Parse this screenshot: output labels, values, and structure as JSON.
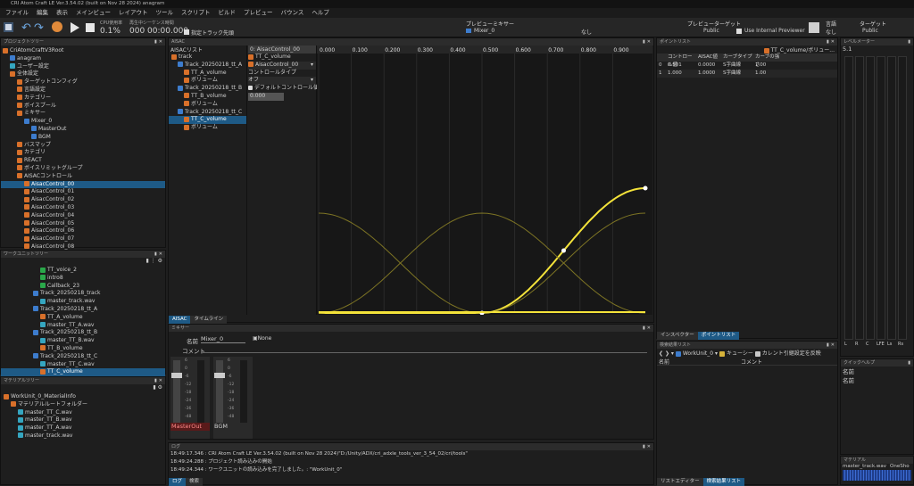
{
  "app": {
    "title": "CRI Atom Craft LE Ver.3.54.02 (built on Nov 28 2024)  anagram"
  },
  "menu": [
    "ファイル",
    "編集",
    "表示",
    "メインビュー",
    "レイアウト",
    "ツール",
    "スクリプト",
    "ビルド",
    "プレビュー",
    "バウンス",
    "ヘルプ"
  ],
  "toolbar": {
    "cpu_label": "CPU使用率",
    "cpu_value": "0.1%",
    "seq_label": "再生中シーケンス時間",
    "seq_value": "000 00:00.000",
    "head_check": "指定トラック先頭",
    "mixer_label": "プレビューミキサー",
    "mixer_value": "Mixer_0",
    "mixer_none": "なし",
    "target_label": "プレビューターゲット",
    "target_value": "Public",
    "internal": "Use Internal Previewer",
    "lang_label": "言語",
    "lang_value": "なし",
    "tgt_label": "ターゲット",
    "tgt_value": "Public"
  },
  "project_tree": {
    "title": "プロジェクトツリー",
    "items": [
      {
        "label": "CriAtomCraftV3Root",
        "indent": 0,
        "icon": "folder",
        "sel": false
      },
      {
        "label": "anagram",
        "indent": 1,
        "icon": "project",
        "sel": false
      },
      {
        "label": "ユーザー設定",
        "indent": 1,
        "icon": "user",
        "sel": false
      },
      {
        "label": "全体設定",
        "indent": 1,
        "icon": "folder",
        "sel": false
      },
      {
        "label": "ターゲットコンフィグ",
        "indent": 2,
        "icon": "folder",
        "sel": false
      },
      {
        "label": "言語設定",
        "indent": 2,
        "icon": "folder",
        "sel": false
      },
      {
        "label": "カテゴリー",
        "indent": 2,
        "icon": "folder",
        "sel": false
      },
      {
        "label": "ボイスプール",
        "indent": 2,
        "icon": "folder",
        "sel": false
      },
      {
        "label": "ミキサー",
        "indent": 2,
        "icon": "folder",
        "sel": false
      },
      {
        "label": "Mixer_0",
        "indent": 3,
        "icon": "mixer",
        "sel": false
      },
      {
        "label": "MasterOut",
        "indent": 4,
        "icon": "bus",
        "sel": false
      },
      {
        "label": "BGM",
        "indent": 4,
        "icon": "bus",
        "sel": false
      },
      {
        "label": "バスマップ",
        "indent": 2,
        "icon": "folder",
        "sel": false
      },
      {
        "label": "カテゴリ",
        "indent": 2,
        "icon": "folder",
        "sel": false
      },
      {
        "label": "REACT",
        "indent": 2,
        "icon": "folder",
        "sel": false
      },
      {
        "label": "ボイスリミットグループ",
        "indent": 2,
        "icon": "folder",
        "sel": false
      },
      {
        "label": "AISACコントロール",
        "indent": 2,
        "icon": "folder",
        "sel": false
      },
      {
        "label": "AisacControl_00",
        "indent": 3,
        "icon": "aisac",
        "sel": true
      },
      {
        "label": "AisacControl_01",
        "indent": 3,
        "icon": "aisac",
        "sel": false
      },
      {
        "label": "AisacControl_02",
        "indent": 3,
        "icon": "aisac",
        "sel": false
      },
      {
        "label": "AisacControl_03",
        "indent": 3,
        "icon": "aisac",
        "sel": false
      },
      {
        "label": "AisacControl_04",
        "indent": 3,
        "icon": "aisac",
        "sel": false
      },
      {
        "label": "AisacControl_05",
        "indent": 3,
        "icon": "aisac",
        "sel": false
      },
      {
        "label": "AisacControl_06",
        "indent": 3,
        "icon": "aisac",
        "sel": false
      },
      {
        "label": "AisacControl_07",
        "indent": 3,
        "icon": "aisac",
        "sel": false
      },
      {
        "label": "AisacControl_08",
        "indent": 3,
        "icon": "aisac",
        "sel": false
      }
    ]
  },
  "workunit_tree": {
    "title": "ワークユニットツリー",
    "items": [
      {
        "label": "TT_voice_2",
        "indent": 5,
        "icon": "cue",
        "sel": false
      },
      {
        "label": "intro8",
        "indent": 5,
        "icon": "cue",
        "sel": false
      },
      {
        "label": "Callback_23",
        "indent": 5,
        "icon": "cue",
        "sel": false
      },
      {
        "label": "Track_20250218_track",
        "indent": 4,
        "icon": "track",
        "sel": false
      },
      {
        "label": "master_track.wav",
        "indent": 5,
        "icon": "wave",
        "sel": false
      },
      {
        "label": "Track_20250218_tt_A",
        "indent": 4,
        "icon": "track",
        "sel": false
      },
      {
        "label": "TT_A_volume",
        "indent": 5,
        "icon": "aisac",
        "sel": false
      },
      {
        "label": "master_TT_A.wav",
        "indent": 5,
        "icon": "wave",
        "sel": false
      },
      {
        "label": "Track_20250218_tt_B",
        "indent": 4,
        "icon": "track",
        "sel": false
      },
      {
        "label": "master_TT_B.wav",
        "indent": 5,
        "icon": "wave",
        "sel": false
      },
      {
        "label": "TT_B_volume",
        "indent": 5,
        "icon": "aisac",
        "sel": false
      },
      {
        "label": "Track_20250218_tt_C",
        "indent": 4,
        "icon": "track",
        "sel": false
      },
      {
        "label": "master_TT_C.wav",
        "indent": 5,
        "icon": "wave",
        "sel": false
      },
      {
        "label": "TT_C_volume",
        "indent": 5,
        "icon": "aisac",
        "sel": true
      }
    ]
  },
  "material_tree": {
    "title": "マテリアルツリー",
    "items": [
      {
        "label": "WorkUnit_0_MaterialInfo",
        "indent": 0,
        "icon": "folder"
      },
      {
        "label": "マテリアルルートフォルダー",
        "indent": 1,
        "icon": "folder"
      },
      {
        "label": "master_TT_C.wav",
        "indent": 2,
        "icon": "wave"
      },
      {
        "label": "master_TT_B.wav",
        "indent": 2,
        "icon": "wave"
      },
      {
        "label": "master_TT_A.wav",
        "indent": 2,
        "icon": "wave"
      },
      {
        "label": "master_track.wav",
        "indent": 2,
        "icon": "wave"
      }
    ]
  },
  "aisac": {
    "panel_title": "AISAC",
    "list_title": "AISACリスト",
    "list": [
      {
        "label": "track",
        "indent": 0,
        "sel": false
      },
      {
        "label": "Track_20250218_tt_A",
        "indent": 1,
        "sel": false
      },
      {
        "label": "TT_A_volume",
        "indent": 2,
        "sel": false
      },
      {
        "label": "ボリューム",
        "indent": 2,
        "sel": false
      },
      {
        "label": "Track_20250218_tt_B",
        "indent": 1,
        "sel": false
      },
      {
        "label": "TT_B_volume",
        "indent": 2,
        "sel": false
      },
      {
        "label": "ボリューム",
        "indent": 2,
        "sel": false
      },
      {
        "label": "Track_20250218_tt_C",
        "indent": 1,
        "sel": false
      },
      {
        "label": "TT_C_volume",
        "indent": 2,
        "sel": true
      },
      {
        "label": "ボリューム",
        "indent": 2,
        "sel": false
      }
    ],
    "header": "0: AisacControl_00",
    "name": "TT_C_volume",
    "control": "AisacControl_00",
    "control_type_label": "コントロールタイプ",
    "control_type": "オフ",
    "default_label": "デフォルトコントロール値",
    "default_value": "0.000",
    "tabs": [
      "AISAC",
      "タイムライン"
    ]
  },
  "chart_data": {
    "type": "line",
    "x_ticks": [
      "0.000",
      "0.100",
      "0.200",
      "0.300",
      "0.400",
      "0.500",
      "0.600",
      "0.700",
      "0.800",
      "0.900"
    ],
    "xlim": [
      0,
      1
    ],
    "ylim": [
      0,
      1
    ],
    "series": [
      {
        "role": "active",
        "color": "#f4e33a",
        "points": [
          [
            0,
            0
          ],
          [
            0.5,
            0
          ],
          [
            1,
            1
          ]
        ],
        "curve": "sine"
      },
      {
        "role": "inactive_A",
        "color": "#7d7424",
        "points": [
          [
            0,
            0.8
          ],
          [
            0.5,
            0
          ],
          [
            1,
            0.8
          ]
        ],
        "curve": "cosine_valley"
      },
      {
        "role": "inactive_B",
        "color": "#7d7424",
        "points": [
          [
            0,
            0
          ],
          [
            0.5,
            0.8
          ],
          [
            1,
            0
          ]
        ],
        "curve": "cosine_peak"
      }
    ],
    "highlight_points": [
      [
        0.5,
        0
      ],
      [
        0.75,
        0.5
      ],
      [
        1,
        1
      ]
    ]
  },
  "point_list": {
    "title": "ポイントリスト",
    "header_label": "TT_C_volume/ボリュー...",
    "columns": [
      "",
      "コントロール値",
      "AISAC値",
      "カーブタイプ",
      "カーブの強さ"
    ],
    "rows": [
      [
        "0",
        "0.501",
        "0.0000",
        "S字曲線",
        "1.00"
      ],
      [
        "1",
        "1.000",
        "1.0000",
        "S字曲線",
        "1.00"
      ]
    ],
    "tabs": [
      "インスペクター",
      "ポイントリスト"
    ]
  },
  "mixer": {
    "title": "ミキサー",
    "name_label": "名前",
    "name_value": "Mixer_0",
    "none_label": "None",
    "comment_label": "コメント",
    "strips": [
      {
        "label": "MasterOut",
        "active": true
      },
      {
        "label": "BGM",
        "active": false
      }
    ],
    "scale": [
      "6",
      "0",
      "-6",
      "-12",
      "-18",
      "-24",
      "-36",
      "-48"
    ]
  },
  "search": {
    "title": "検索結果リスト",
    "workunit": "WorkUnit_0",
    "cue_label": "キューシー",
    "current_label": "カレント引継設定を反映",
    "name_col": "名前",
    "comment_col": "コメント",
    "tabs": [
      "リストエディター",
      "検索結果リスト"
    ]
  },
  "level_meter": {
    "title": "レベルメーター",
    "value": "5.1",
    "channels": [
      "L",
      "R",
      "C",
      "LFE",
      "Ls",
      "Rs"
    ]
  },
  "quick_help": {
    "title": "クイックヘルプ",
    "label": "名前",
    "value": "名前"
  },
  "material_pane": {
    "title": "マテリアル",
    "item1": "master_track.wav",
    "item2": "OneSho"
  },
  "log": {
    "title": "ログ",
    "lines": [
      "18:49:17.346 : CRI Atom Craft LE Ver.3.54.02 (built on Nov 28 2024)\"D:/Unity/ADX/cri_adxle_tools_ver_3_54_02/cri/tools\"",
      "18:49:24.288 : プロジェクト読み込みの開始",
      "18:49:24.344 : ワークユニットの読み込みを完了しました。: \"WorkUnit_0\""
    ],
    "tabs": [
      "ログ",
      "検索"
    ]
  }
}
